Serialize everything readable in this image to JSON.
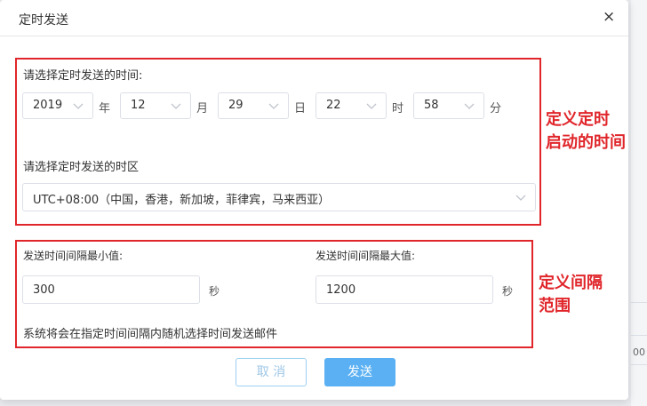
{
  "dialog": {
    "title": "定时发送",
    "close_icon": "×"
  },
  "schedule": {
    "time_prompt": "请选择定时发送的时间:",
    "year": {
      "value": "2019",
      "unit": "年"
    },
    "month": {
      "value": "12",
      "unit": "月"
    },
    "day": {
      "value": "29",
      "unit": "日"
    },
    "hour": {
      "value": "22",
      "unit": "时"
    },
    "minute": {
      "value": "58",
      "unit": "分"
    },
    "timezone_prompt": "请选择定时发送的时区",
    "timezone_value": "UTC+08:00（中国，香港，新加坡，菲律宾，马来西亚）"
  },
  "interval": {
    "min_label": "发送时间间隔最小值:",
    "min_value": "300",
    "min_unit": "秒",
    "max_label": "发送时间间隔最大值:",
    "max_value": "1200",
    "max_unit": "秒",
    "note": "系统将会在指定时间间隔内随机选择时间发送邮件"
  },
  "annotations": {
    "schedule_line1": "定义定时",
    "schedule_line2": "启动的时间",
    "interval_line1": "定义间隔",
    "interval_line2": "范围",
    "color": "#e0262b"
  },
  "buttons": {
    "cancel": "取 消",
    "send": "发送"
  },
  "background": {
    "partial_text": "00"
  },
  "colors": {
    "primary": "#5ab0f2",
    "annotation_red": "#e0262b"
  }
}
